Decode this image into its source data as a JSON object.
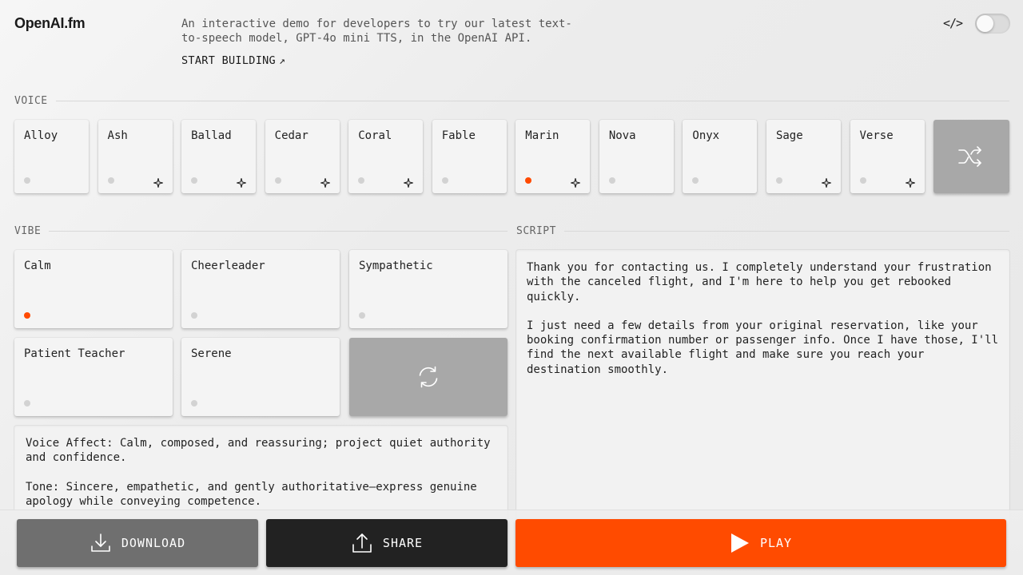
{
  "header": {
    "logo": "OpenAI.fm",
    "intro": "An interactive demo for developers to try our latest text-to-speech model, GPT-4o mini TTS, in the OpenAI API.",
    "start_building": "START BUILDING",
    "start_arrow": "↗",
    "code_icon": "code-icon",
    "toggle_on": false
  },
  "voice": {
    "label": "VOICE",
    "selected": "Marin",
    "items": [
      {
        "name": "Alloy",
        "new": false
      },
      {
        "name": "Ash",
        "new": true
      },
      {
        "name": "Ballad",
        "new": true
      },
      {
        "name": "Cedar",
        "new": true
      },
      {
        "name": "Coral",
        "new": true
      },
      {
        "name": "Fable",
        "new": false
      },
      {
        "name": "Marin",
        "new": true
      },
      {
        "name": "Nova",
        "new": false
      },
      {
        "name": "Onyx",
        "new": false
      },
      {
        "name": "Sage",
        "new": true
      },
      {
        "name": "Verse",
        "new": true
      }
    ],
    "shuffle_icon": "shuffle-icon"
  },
  "vibe": {
    "label": "VIBE",
    "selected": "Calm",
    "items": [
      "Calm",
      "Cheerleader",
      "Sympathetic",
      "Patient Teacher",
      "Serene"
    ],
    "refresh_icon": "refresh-icon",
    "description": [
      "Voice Affect: Calm, composed, and reassuring; project quiet authority and confidence.",
      "Tone: Sincere, empathetic, and gently authoritative—express genuine apology while conveying competence."
    ]
  },
  "script": {
    "label": "SCRIPT",
    "paragraphs": [
      "Thank you for contacting us. I completely understand your frustration with the canceled flight, and I'm here to help you get rebooked quickly.",
      "I just need a few details from your original reservation, like your booking confirmation number or passenger info. Once I have those, I'll find the next available flight and make sure you reach your destination smoothly."
    ]
  },
  "actions": {
    "download": "DOWNLOAD",
    "share": "SHARE",
    "play": "PLAY"
  },
  "colors": {
    "accent": "#ff4b00",
    "dot_inactive": "#d2d2d2"
  }
}
